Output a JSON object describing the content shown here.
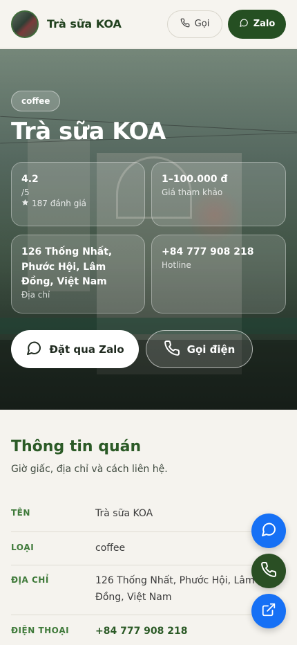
{
  "header": {
    "brand": "Trà sữa KOA",
    "call_label": "Gọi",
    "zalo_label": "Zalo"
  },
  "hero": {
    "category_chip": "coffee",
    "title": "Trà sữa KOA",
    "rating": {
      "value": "4.2",
      "scale": "/5",
      "count": "187 đánh giá"
    },
    "price": {
      "value": "1–100.000 đ",
      "label": "Giá tham khảo"
    },
    "address": {
      "value": "126 Thống Nhất, Phước Hội, Lâm Đồng, Việt Nam",
      "label": "Địa chỉ"
    },
    "hotline": {
      "value": "+84 777 908 218",
      "label": "Hotline"
    },
    "cta_zalo": "Đặt qua Zalo",
    "cta_call": "Gọi điện"
  },
  "info": {
    "title": "Thông tin quán",
    "subtitle": "Giờ giấc, địa chỉ và cách liên hệ.",
    "rows": [
      {
        "key": "TÊN",
        "value": "Trà sữa KOA"
      },
      {
        "key": "LOẠI",
        "value": "coffee"
      },
      {
        "key": "ĐỊA CHỈ",
        "value": "126 Thống Nhất, Phước Hội, Lâm Đồng, Việt Nam"
      },
      {
        "key": "ĐIỆN THOẠI",
        "value": "+84 777 908 218"
      }
    ]
  },
  "fabs": [
    "chat-icon",
    "phone-icon",
    "external-link-icon"
  ],
  "colors": {
    "primary": "#254f22",
    "zalo_blue": "#1670f5",
    "accent_text": "#2b5a26"
  }
}
